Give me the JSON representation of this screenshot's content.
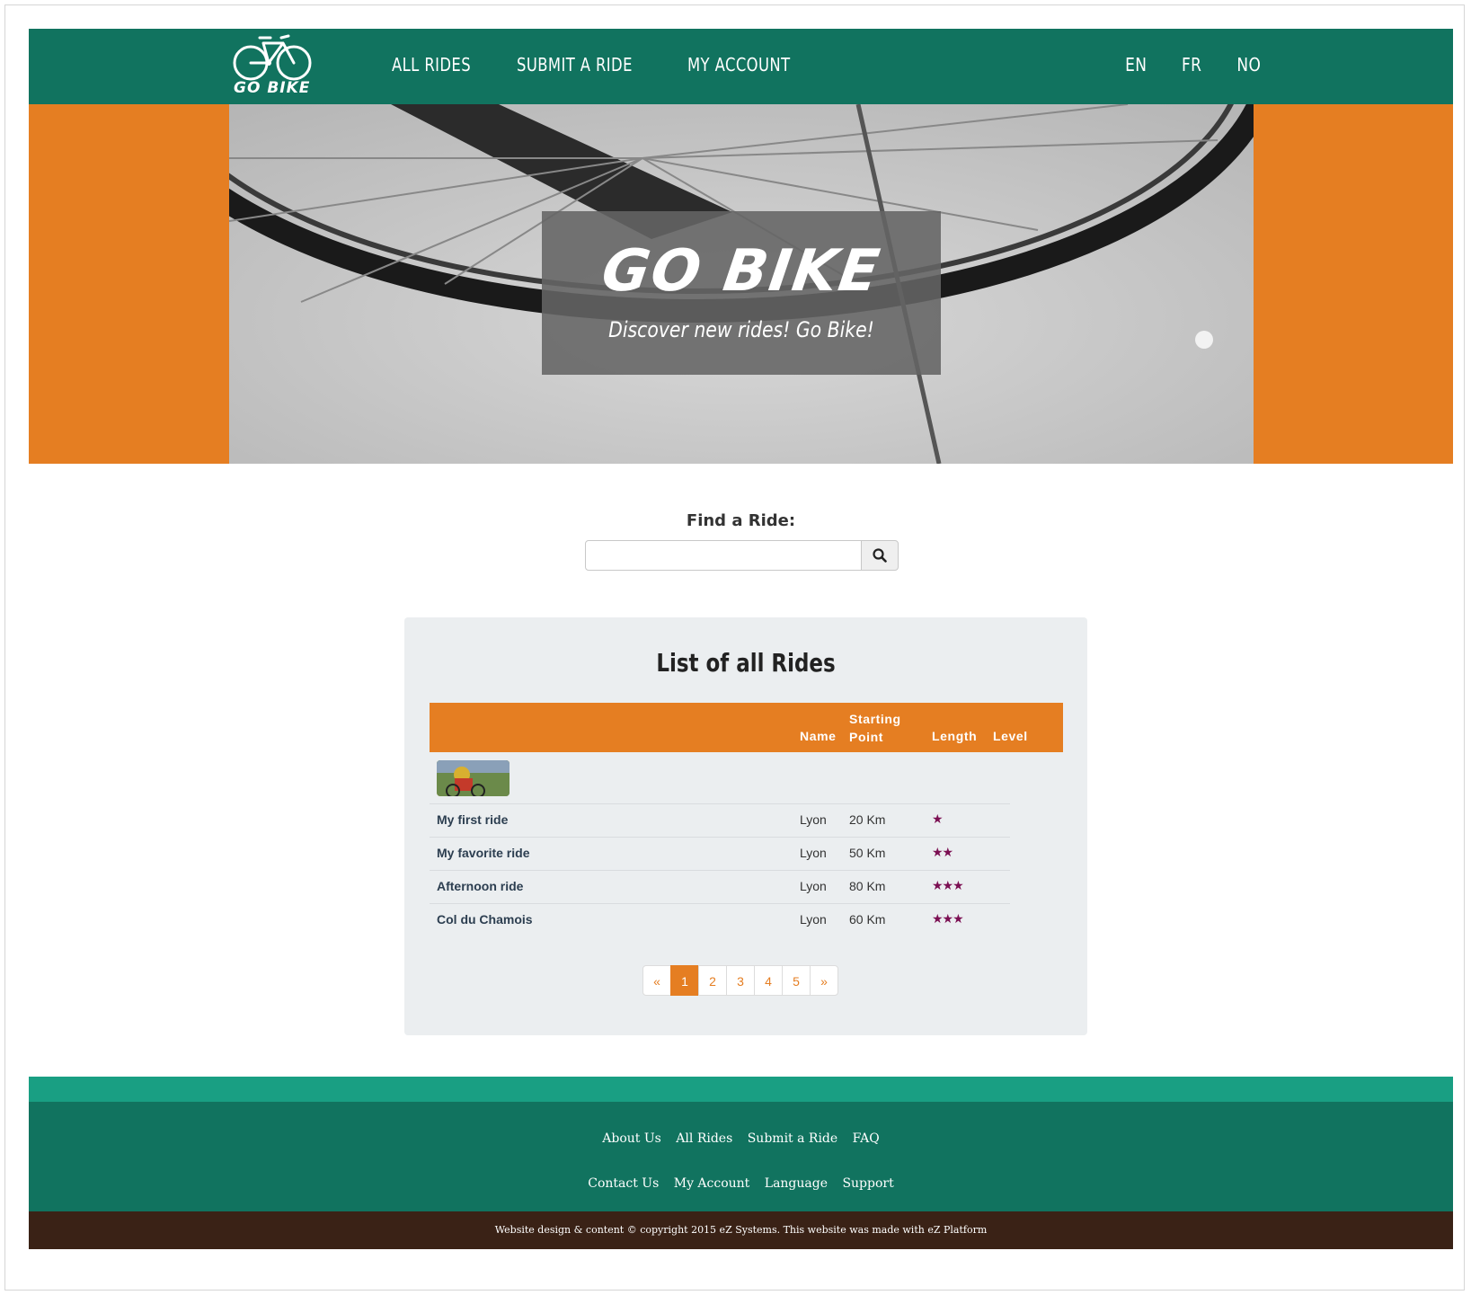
{
  "brand": {
    "logo_text": "GO BIKE"
  },
  "nav": {
    "items": [
      {
        "label": "ALL RIDES"
      },
      {
        "label": "SUBMIT A RIDE"
      },
      {
        "label": "MY ACCOUNT"
      }
    ],
    "languages": [
      {
        "label": "EN"
      },
      {
        "label": "FR"
      },
      {
        "label": "NO"
      }
    ]
  },
  "hero": {
    "title": "GO BIKE",
    "subtitle": "Discover new rides! Go Bike!"
  },
  "search": {
    "label": "Find a Ride:",
    "value": "",
    "placeholder": "",
    "icon": "search-icon"
  },
  "rides_list": {
    "title": "List of all Rides",
    "columns": {
      "name": "Name",
      "starting_point": "Starting Point",
      "length": "Length",
      "level": "Level"
    },
    "rows": [
      {
        "name": "My first ride",
        "start": "Lyon",
        "length": "20 Km",
        "level": 1,
        "stars": "★"
      },
      {
        "name": "My favorite ride",
        "start": "Lyon",
        "length": "50 Km",
        "level": 2,
        "stars": "★★"
      },
      {
        "name": "Afternoon ride",
        "start": "Lyon",
        "length": "80 Km",
        "level": 3,
        "stars": "★★★"
      },
      {
        "name": "Col du Chamois",
        "start": "Lyon",
        "length": "60 Km",
        "level": 3,
        "stars": "★★★"
      }
    ],
    "pagination": {
      "prev": "«",
      "next": "»",
      "pages": [
        "1",
        "2",
        "3",
        "4",
        "5"
      ],
      "current": "1"
    }
  },
  "footer": {
    "row1": [
      {
        "label": "About Us"
      },
      {
        "label": "All Rides"
      },
      {
        "label": "Submit a Ride"
      },
      {
        "label": "FAQ"
      }
    ],
    "row2": [
      {
        "label": "Contact Us"
      },
      {
        "label": "My Account"
      },
      {
        "label": "Language"
      },
      {
        "label": "Support"
      }
    ],
    "copyright": "Website design & content © copyright 2015 eZ Systems. This website was made with eZ Platform"
  },
  "colors": {
    "header": "#11735f",
    "accent_orange": "#e57e22",
    "footer_stripe": "#199f83",
    "copyright_bar": "#3a2216",
    "stars": "#7b0f52"
  }
}
